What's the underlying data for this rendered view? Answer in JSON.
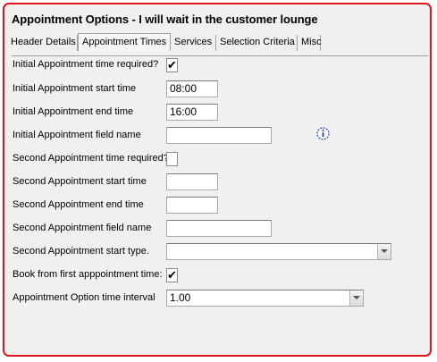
{
  "group": {
    "title": "Appointment Options - I will wait in the customer lounge"
  },
  "tabs": [
    {
      "label": "Header Details"
    },
    {
      "label": "Appointment Times"
    },
    {
      "label": "Services"
    },
    {
      "label": "Selection Criteria"
    },
    {
      "label": "Misc"
    }
  ],
  "form": {
    "initial_required": {
      "label": "Initial Appointment time required?",
      "checked": true,
      "mark": "✔"
    },
    "initial_start": {
      "label": "Initial Appointment start time",
      "value": "08:00"
    },
    "initial_end": {
      "label": "Initial Appointment end time",
      "value": "16:00"
    },
    "initial_field": {
      "label": "Initial Appointment field name",
      "value": ""
    },
    "second_required": {
      "label": "Second Appointment time required?",
      "checked": false,
      "mark": ""
    },
    "second_start": {
      "label": "Second Appointment start time",
      "value": ""
    },
    "second_end": {
      "label": "Second Appointment end time",
      "value": ""
    },
    "second_field": {
      "label": "Second Appointment field name",
      "value": ""
    },
    "second_type": {
      "label": "Second Appointment start type.",
      "value": ""
    },
    "book_first": {
      "label": "Book from first apppointment time:",
      "checked": true,
      "mark": "✔"
    },
    "interval": {
      "label": "Appointment Option time interval",
      "value": "1.00"
    }
  },
  "icons": {
    "info": "info-icon"
  },
  "colors": {
    "border_accent": "#e0141a",
    "panel_bg": "#f0f0f0"
  }
}
